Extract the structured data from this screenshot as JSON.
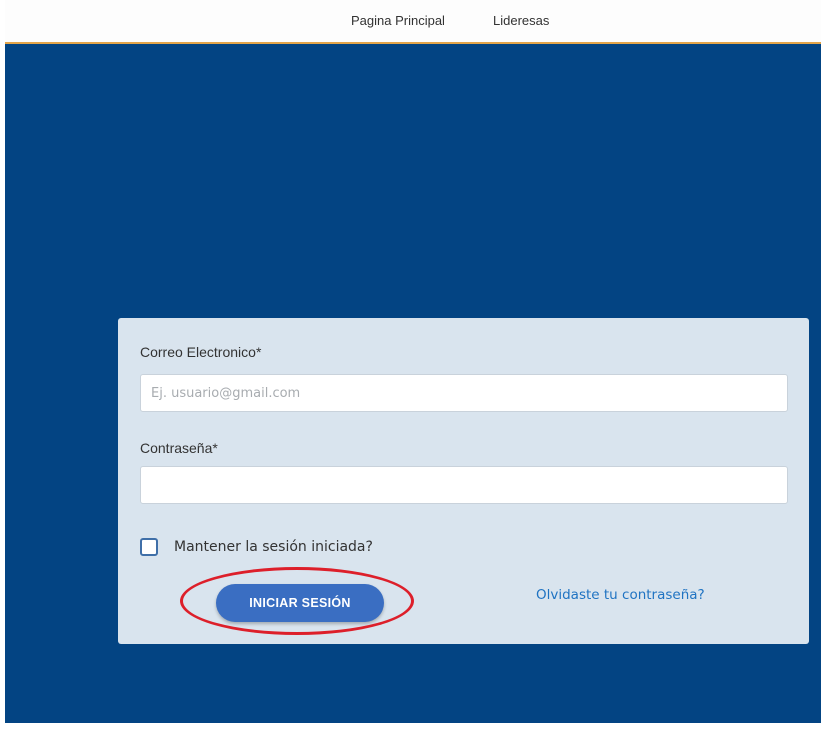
{
  "nav": {
    "links": [
      {
        "label": "Pagina Principal"
      },
      {
        "label": "Lideresas"
      }
    ]
  },
  "login": {
    "email_label": "Correo Electronico*",
    "email_placeholder": "Ej. usuario@gmail.com",
    "email_value": "",
    "password_label": "Contraseña*",
    "password_value": "",
    "remember_label": "Mantener la sesión iniciada?",
    "remember_checked": false,
    "submit_label": "INICIAR SESIÓN",
    "forgot_label": "Olvidaste tu contraseña?"
  },
  "colors": {
    "hero_background": "#034483",
    "card_background": "#d9e4ee",
    "button": "#3a6ec2",
    "link": "#1f73c2",
    "annotation_ring": "#dd1f2a",
    "nav_accent": "#e3a54a"
  }
}
